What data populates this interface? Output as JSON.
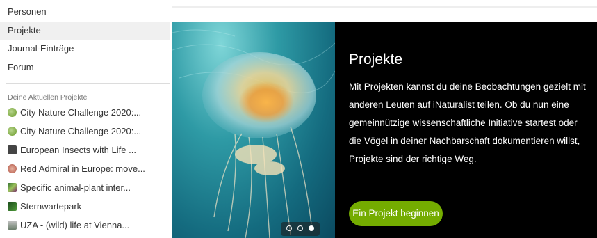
{
  "menu": {
    "items": [
      {
        "label": "Personen"
      },
      {
        "label": "Projekte"
      },
      {
        "label": "Journal-Einträge"
      },
      {
        "label": "Forum"
      }
    ],
    "section_label": "Deine Aktuellen Projekte",
    "projects": [
      {
        "label": "City Nature Challenge 2020:...",
        "icon": "green-dot-icon"
      },
      {
        "label": "City Nature Challenge 2020:...",
        "icon": "green-dot-icon"
      },
      {
        "label": "European Insects with Life ...",
        "icon": "briefcase-icon"
      },
      {
        "label": "Red Admiral in Europe: move...",
        "icon": "butterfly-icon"
      },
      {
        "label": "Specific animal-plant inter...",
        "icon": "plant-photo-icon"
      },
      {
        "label": "Sternwartepark",
        "icon": "leaf-photo-icon"
      },
      {
        "label": "UZA - (wild) life at Vienna...",
        "icon": "bird-photo-icon"
      }
    ]
  },
  "hero": {
    "title": "Projekte",
    "body": "Mit Projekten kannst du deine Beobachtungen gezielt mit anderen Leuten auf iNaturalist teilen. Ob du nun eine gemeinnützige wissenschaftliche Initiative startest oder die Vögel in deiner Nachbarschaft dokumentieren willst, Projekte sind der richtige Weg.",
    "cta_label": "Ein Projekt beginnen",
    "carousel_active": 3,
    "carousel_count": 3
  },
  "colors": {
    "accent": "#74ac00",
    "hero_bg": "#000000"
  }
}
